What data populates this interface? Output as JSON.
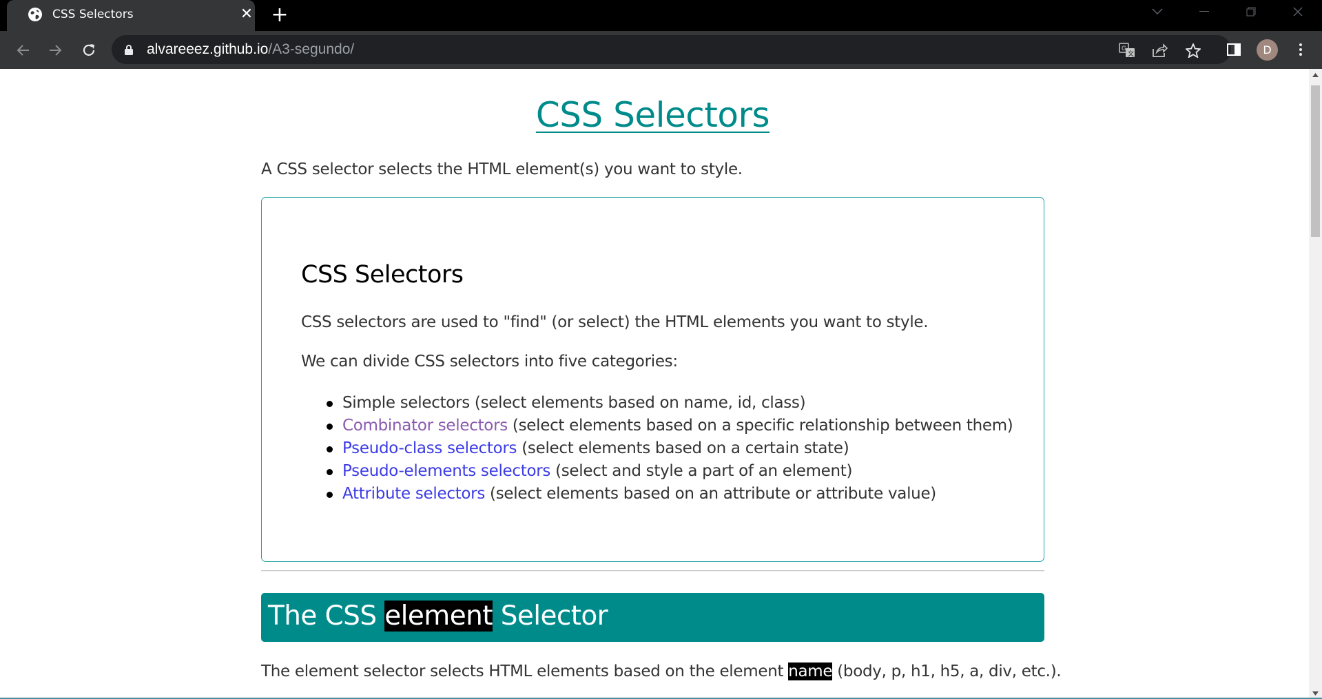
{
  "browser": {
    "tab": {
      "title": "CSS Selectors",
      "favicon": "globe-icon"
    },
    "new_tab_label": "+",
    "close_tab_label": "✕",
    "address": {
      "host": "alvareeez.github.io",
      "path": "/A3-segundo/"
    },
    "profile_initial": "D",
    "colors": {
      "frame": "#000000",
      "toolbar": "#353638",
      "omnibox": "#202124",
      "avatar": "#a1887f"
    }
  },
  "page": {
    "title": "CSS Selectors",
    "intro": "A CSS selector selects the HTML element(s) you want to style.",
    "card": {
      "title": "CSS Selectors",
      "p1": "CSS selectors are used to \"find\" (or select) the HTML elements you want to style.",
      "p2": "We can divide CSS selectors into five categories:",
      "items": [
        {
          "link": "",
          "text": "Simple selectors (select elements based on name, id, class)"
        },
        {
          "link": "Combinator selectors",
          "text": " (select elements based on a specific relationship between them)",
          "visited": true
        },
        {
          "link": "Pseudo-class selectors",
          "text": " (select elements based on a certain state)"
        },
        {
          "link": "Pseudo-elements selectors",
          "text": " (select and style a part of an element)"
        },
        {
          "link": "Attribute selectors",
          "text": " (select elements based on an attribute or attribute value)"
        }
      ]
    },
    "section": {
      "title_before": "The CSS ",
      "title_highlight": "element",
      "title_after": " Selector",
      "p_before": "The element selector selects HTML elements based on the element ",
      "p_highlight": "name",
      "p_after": " (body, p, h1, h5, a, div, etc.)."
    },
    "colors": {
      "accent": "#008b8b",
      "link": "#3c3ce6",
      "visited_link": "#8a5ab0",
      "text": "#333333"
    }
  }
}
